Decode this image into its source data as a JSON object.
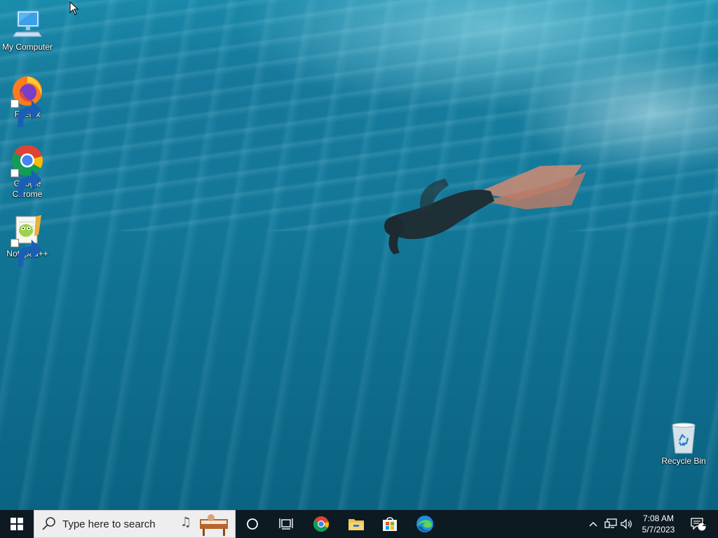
{
  "desktop": {
    "icons": [
      {
        "label": "My Computer",
        "icon": "monitor-icon"
      },
      {
        "label": "Firefox",
        "icon": "firefox-icon"
      },
      {
        "label": "Google Chrome",
        "icon": "chrome-icon"
      },
      {
        "label": "Notepad++",
        "icon": "notepadpp-icon"
      },
      {
        "label": "Recycle Bin",
        "icon": "recycle-bin-icon"
      }
    ]
  },
  "taskbar": {
    "start_icon": "windows-logo-icon",
    "search_placeholder": "Type here to search",
    "pinned": [
      "cortana-icon",
      "task-view-icon",
      "chrome-icon",
      "file-explorer-icon",
      "store-icon",
      "edge-icon"
    ],
    "tray": {
      "time": "7:08 AM",
      "date": "5/7/2023",
      "notification_count": "1"
    }
  },
  "colors": {
    "taskbar_bg": "#0d1a22",
    "search_bg": "#eeeeee",
    "water": "#13789a"
  }
}
